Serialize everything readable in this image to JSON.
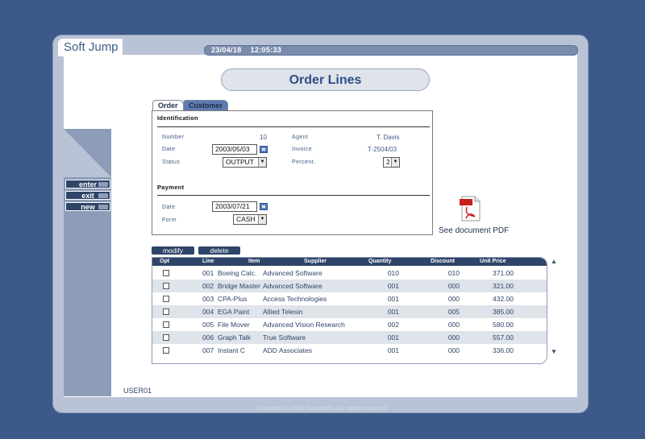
{
  "app": {
    "title": "Soft Jump",
    "datetime": "23/04/18    12:05:33",
    "user": "USER01",
    "copyright": "Copyright © 2002 Transtools. All rights reserved."
  },
  "page": {
    "title": "Order Lines"
  },
  "sidebar": {
    "enter": "enter",
    "exit": "exit",
    "new": "new"
  },
  "tabs": {
    "order": "Order",
    "customer": "Customer"
  },
  "identification": {
    "heading": "Identification",
    "number_label": "Number",
    "number_value": "10",
    "agent_label": "Agent",
    "agent_value": "T. Davis",
    "date_label": "Date",
    "date_value": "2003/05/03",
    "invoice_label": "Invoice",
    "invoice_value": "T-2504/03",
    "status_label": "Status",
    "status_value": "OUTPUT",
    "percent_label": "Percent.",
    "percent_value": "2"
  },
  "payment": {
    "heading": "Payment",
    "date_label": "Date",
    "date_value": "2003/07/21",
    "form_label": "Form",
    "form_value": "CASH"
  },
  "pdf": {
    "label": "See document PDF",
    "icon": "pdf-icon"
  },
  "actions": {
    "modify": "modify",
    "delete": "delete"
  },
  "table": {
    "headers": {
      "opt": "Opt",
      "line": "Line",
      "item": "Item",
      "supplier": "Supplier",
      "quantity": "Quantity",
      "discount": "Discount",
      "unit_price": "Unit Price"
    },
    "rows": [
      {
        "line": "001",
        "item": "Boeing Calc.",
        "supplier": "Advanced Software",
        "quantity": "010",
        "discount": "010",
        "unit_price": "371.00"
      },
      {
        "line": "002",
        "item": "Bridge Master",
        "supplier": "Advanced Software",
        "quantity": "001",
        "discount": "000",
        "unit_price": "321.00"
      },
      {
        "line": "003",
        "item": "CPA-Plus",
        "supplier": "Access Technologies",
        "quantity": "001",
        "discount": "000",
        "unit_price": "432.00"
      },
      {
        "line": "004",
        "item": "EGA Paint",
        "supplier": "Allied Telesin",
        "quantity": "001",
        "discount": "005",
        "unit_price": "385.00"
      },
      {
        "line": "005",
        "item": "File Mover",
        "supplier": "Advanced Vision Research",
        "quantity": "002",
        "discount": "000",
        "unit_price": "580.00"
      },
      {
        "line": "006",
        "item": "Graph Talk",
        "supplier": "True Software",
        "quantity": "001",
        "discount": "000",
        "unit_price": "557.00"
      },
      {
        "line": "007",
        "item": "Instant C",
        "supplier": "ADD Associates",
        "quantity": "001",
        "discount": "000",
        "unit_price": "336.00"
      }
    ]
  },
  "colors": {
    "background": "#3b5a8a",
    "accent": "#2e4468",
    "title": "#2f4f86"
  }
}
